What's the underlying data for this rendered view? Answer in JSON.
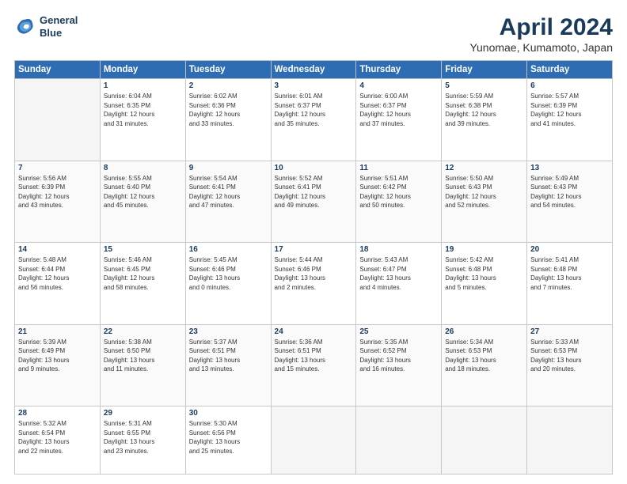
{
  "header": {
    "logo_line1": "General",
    "logo_line2": "Blue",
    "title": "April 2024",
    "subtitle": "Yunomae, Kumamoto, Japan"
  },
  "columns": [
    "Sunday",
    "Monday",
    "Tuesday",
    "Wednesday",
    "Thursday",
    "Friday",
    "Saturday"
  ],
  "weeks": [
    [
      {
        "day": "",
        "info": ""
      },
      {
        "day": "1",
        "info": "Sunrise: 6:04 AM\nSunset: 6:35 PM\nDaylight: 12 hours\nand 31 minutes."
      },
      {
        "day": "2",
        "info": "Sunrise: 6:02 AM\nSunset: 6:36 PM\nDaylight: 12 hours\nand 33 minutes."
      },
      {
        "day": "3",
        "info": "Sunrise: 6:01 AM\nSunset: 6:37 PM\nDaylight: 12 hours\nand 35 minutes."
      },
      {
        "day": "4",
        "info": "Sunrise: 6:00 AM\nSunset: 6:37 PM\nDaylight: 12 hours\nand 37 minutes."
      },
      {
        "day": "5",
        "info": "Sunrise: 5:59 AM\nSunset: 6:38 PM\nDaylight: 12 hours\nand 39 minutes."
      },
      {
        "day": "6",
        "info": "Sunrise: 5:57 AM\nSunset: 6:39 PM\nDaylight: 12 hours\nand 41 minutes."
      }
    ],
    [
      {
        "day": "7",
        "info": "Sunrise: 5:56 AM\nSunset: 6:39 PM\nDaylight: 12 hours\nand 43 minutes."
      },
      {
        "day": "8",
        "info": "Sunrise: 5:55 AM\nSunset: 6:40 PM\nDaylight: 12 hours\nand 45 minutes."
      },
      {
        "day": "9",
        "info": "Sunrise: 5:54 AM\nSunset: 6:41 PM\nDaylight: 12 hours\nand 47 minutes."
      },
      {
        "day": "10",
        "info": "Sunrise: 5:52 AM\nSunset: 6:41 PM\nDaylight: 12 hours\nand 49 minutes."
      },
      {
        "day": "11",
        "info": "Sunrise: 5:51 AM\nSunset: 6:42 PM\nDaylight: 12 hours\nand 50 minutes."
      },
      {
        "day": "12",
        "info": "Sunrise: 5:50 AM\nSunset: 6:43 PM\nDaylight: 12 hours\nand 52 minutes."
      },
      {
        "day": "13",
        "info": "Sunrise: 5:49 AM\nSunset: 6:43 PM\nDaylight: 12 hours\nand 54 minutes."
      }
    ],
    [
      {
        "day": "14",
        "info": "Sunrise: 5:48 AM\nSunset: 6:44 PM\nDaylight: 12 hours\nand 56 minutes."
      },
      {
        "day": "15",
        "info": "Sunrise: 5:46 AM\nSunset: 6:45 PM\nDaylight: 12 hours\nand 58 minutes."
      },
      {
        "day": "16",
        "info": "Sunrise: 5:45 AM\nSunset: 6:46 PM\nDaylight: 13 hours\nand 0 minutes."
      },
      {
        "day": "17",
        "info": "Sunrise: 5:44 AM\nSunset: 6:46 PM\nDaylight: 13 hours\nand 2 minutes."
      },
      {
        "day": "18",
        "info": "Sunrise: 5:43 AM\nSunset: 6:47 PM\nDaylight: 13 hours\nand 4 minutes."
      },
      {
        "day": "19",
        "info": "Sunrise: 5:42 AM\nSunset: 6:48 PM\nDaylight: 13 hours\nand 5 minutes."
      },
      {
        "day": "20",
        "info": "Sunrise: 5:41 AM\nSunset: 6:48 PM\nDaylight: 13 hours\nand 7 minutes."
      }
    ],
    [
      {
        "day": "21",
        "info": "Sunrise: 5:39 AM\nSunset: 6:49 PM\nDaylight: 13 hours\nand 9 minutes."
      },
      {
        "day": "22",
        "info": "Sunrise: 5:38 AM\nSunset: 6:50 PM\nDaylight: 13 hours\nand 11 minutes."
      },
      {
        "day": "23",
        "info": "Sunrise: 5:37 AM\nSunset: 6:51 PM\nDaylight: 13 hours\nand 13 minutes."
      },
      {
        "day": "24",
        "info": "Sunrise: 5:36 AM\nSunset: 6:51 PM\nDaylight: 13 hours\nand 15 minutes."
      },
      {
        "day": "25",
        "info": "Sunrise: 5:35 AM\nSunset: 6:52 PM\nDaylight: 13 hours\nand 16 minutes."
      },
      {
        "day": "26",
        "info": "Sunrise: 5:34 AM\nSunset: 6:53 PM\nDaylight: 13 hours\nand 18 minutes."
      },
      {
        "day": "27",
        "info": "Sunrise: 5:33 AM\nSunset: 6:53 PM\nDaylight: 13 hours\nand 20 minutes."
      }
    ],
    [
      {
        "day": "28",
        "info": "Sunrise: 5:32 AM\nSunset: 6:54 PM\nDaylight: 13 hours\nand 22 minutes."
      },
      {
        "day": "29",
        "info": "Sunrise: 5:31 AM\nSunset: 6:55 PM\nDaylight: 13 hours\nand 23 minutes."
      },
      {
        "day": "30",
        "info": "Sunrise: 5:30 AM\nSunset: 6:56 PM\nDaylight: 13 hours\nand 25 minutes."
      },
      {
        "day": "",
        "info": ""
      },
      {
        "day": "",
        "info": ""
      },
      {
        "day": "",
        "info": ""
      },
      {
        "day": "",
        "info": ""
      }
    ]
  ]
}
